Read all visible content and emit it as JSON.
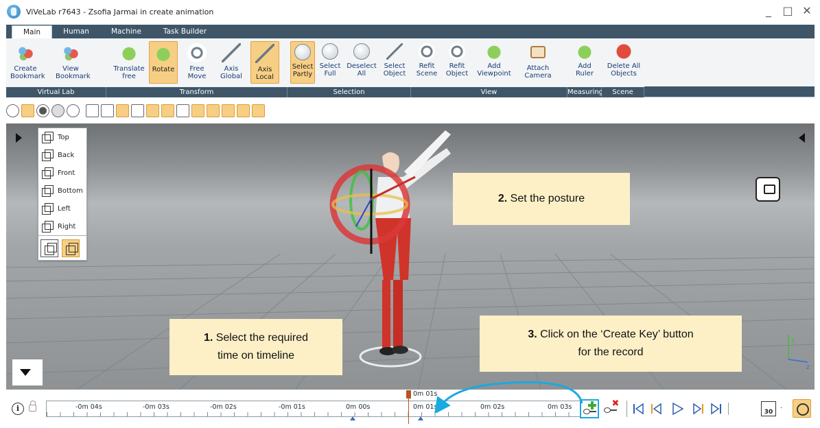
{
  "window": {
    "title": "ViVeLab r7643 - Zsofia Jarmai in create animation",
    "minimize": "_",
    "maximize": "□",
    "close": "✕"
  },
  "ribbon_tabs": [
    "Main",
    "Human",
    "Machine",
    "Task Builder"
  ],
  "ribbon": {
    "groups": {
      "virtual_lab": "Virtual Lab",
      "transform": "Transform",
      "selection": "Selection",
      "view": "View",
      "measuring": "Measuring",
      "scene": "Scene"
    },
    "buttons": {
      "create_bookmark": "Create\nBookmark",
      "view_bookmark": "View\nBookmark",
      "translate_free": "Translate\nfree",
      "rotate": "Rotate",
      "free_move": "Free\nMove",
      "axis_global": "Axis\nGlobal",
      "axis_local": "Axis\nLocal",
      "select_partly": "Select\nPartly",
      "select_full": "Select\nFull",
      "deselect_all": "Deselect\nAll",
      "select_object": "Select\nObject",
      "refit_scene": "Refit\nScene",
      "refit_object": "Refit\nObject",
      "add_viewpoint": "Add\nViewpoint",
      "attach_camera": "Attach\nCamera",
      "add_ruler": "Add\nRuler",
      "delete_all_objects": "Delete All\nObjects"
    }
  },
  "view_menu": [
    "Top",
    "Back",
    "Front",
    "Bottom",
    "Left",
    "Right"
  ],
  "axis_labels": {
    "y": "y",
    "z": "z"
  },
  "callouts": {
    "step1_num": "1.",
    "step1_text": "Select the required",
    "step1_line2": "time on timeline",
    "step2_num": "2.",
    "step2_text": "Set the posture",
    "step3_num": "3.",
    "step3_text": "Click on the ‘Create Key’ button",
    "step3_line2": "for the record"
  },
  "timeline": {
    "labels": [
      "-0m 04s",
      "-0m 03s",
      "-0m 02s",
      "-0m 01s",
      "0m 00s",
      "0m 01s",
      "0m 02s",
      "0m 03s"
    ],
    "cursor_label": "0m 01s",
    "fps": "30",
    "info": "i"
  }
}
